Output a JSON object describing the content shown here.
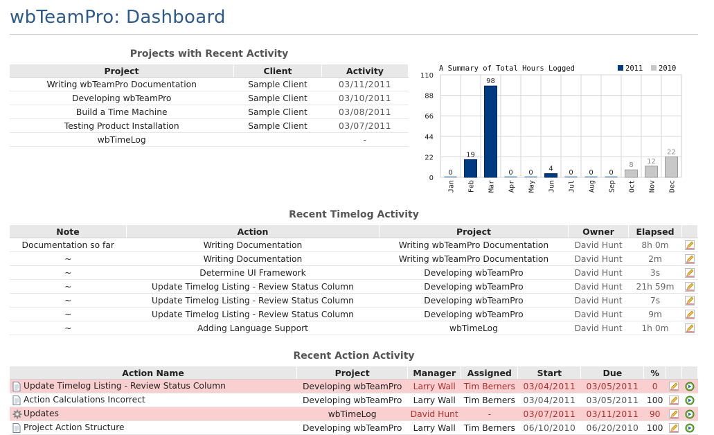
{
  "page": {
    "title": "wbTeamPro: Dashboard"
  },
  "projects": {
    "title": "Projects with Recent Activity",
    "headers": [
      "Project",
      "Client",
      "Activity"
    ],
    "rows": [
      [
        "Writing wbTeamPro Documentation",
        "Sample Client",
        "03/11/2011"
      ],
      [
        "Developing wbTeamPro",
        "Sample Client",
        "03/10/2011"
      ],
      [
        "Build a Time Machine",
        "Sample Client",
        "03/08/2011"
      ],
      [
        "Testing Product Installation",
        "Sample Client",
        "03/07/2011"
      ],
      [
        "wbTimeLog",
        "",
        "-"
      ]
    ]
  },
  "chart_data": {
    "type": "bar",
    "title": "A Summary of Total Hours Logged",
    "categories": [
      "Jan",
      "Feb",
      "Mar",
      "Apr",
      "May",
      "Jun",
      "Jul",
      "Aug",
      "Sep",
      "Oct",
      "Nov",
      "Dec"
    ],
    "series": [
      {
        "name": "2011",
        "color": "#003a80",
        "values": [
          0,
          19,
          98,
          0,
          0,
          4,
          0,
          0,
          0,
          0,
          0,
          0
        ]
      },
      {
        "name": "2010",
        "color": "#c8c8c8",
        "values": [
          0,
          0,
          0,
          0,
          0,
          0,
          0,
          0,
          0,
          8,
          12,
          22
        ]
      }
    ],
    "ylim": [
      0,
      110
    ],
    "yticks": [
      0,
      22,
      44,
      66,
      88,
      110
    ],
    "value_labels": [
      "0",
      "19",
      "98",
      "0",
      "0",
      "4",
      "0",
      "0",
      "0",
      "8",
      "12",
      "22"
    ],
    "grid": true,
    "legend": "top-right"
  },
  "timelog": {
    "title": "Recent Timelog Activity",
    "headers": [
      "Note",
      "Action",
      "Project",
      "Owner",
      "Elapsed"
    ],
    "rows": [
      [
        "Documentation so far",
        "Writing Documentation",
        "Writing wbTeamPro Documentation",
        "David Hunt",
        "8h 0m"
      ],
      [
        "~",
        "Writing Documentation",
        "Writing wbTeamPro Documentation",
        "David Hunt",
        "2m"
      ],
      [
        "~",
        "Determine UI Framework",
        "Developing wbTeamPro",
        "David Hunt",
        "3s"
      ],
      [
        "~",
        "Update Timelog Listing - Review Status Column",
        "Developing wbTeamPro",
        "David Hunt",
        "21h 59m"
      ],
      [
        "~",
        "Update Timelog Listing - Review Status Column",
        "Developing wbTeamPro",
        "David Hunt",
        "7s"
      ],
      [
        "~",
        "Update Timelog Listing - Review Status Column",
        "Developing wbTeamPro",
        "David Hunt",
        "9m"
      ],
      [
        "~",
        "Adding Language Support",
        "wbTimeLog",
        "David Hunt",
        "1h 0m"
      ]
    ],
    "edit_icon": "pencil-edit-icon"
  },
  "actions": {
    "title": "Recent Action Activity",
    "headers": [
      "Action Name",
      "Project",
      "Manager",
      "Assigned",
      "Start",
      "Due",
      "%"
    ],
    "rows": [
      {
        "icon": "document-icon",
        "highlight": true,
        "cells": [
          "Update Timelog Listing - Review Status Column",
          "Developing wbTeamPro",
          "Larry Wall",
          "Tim Berners",
          "03/04/2011",
          "03/05/2011",
          "0"
        ]
      },
      {
        "icon": "document-icon",
        "highlight": false,
        "cells": [
          "Action Calculations Incorrect",
          "Developing wbTeamPro",
          "Larry Wall",
          "Tim Berners",
          "03/04/2011",
          "03/05/2011",
          "100"
        ]
      },
      {
        "icon": "gear-icon",
        "highlight": true,
        "cells": [
          "Updates",
          "wbTimeLog",
          "David Hunt",
          "-",
          "03/07/2011",
          "03/11/2011",
          "90"
        ]
      },
      {
        "icon": "document-icon",
        "highlight": false,
        "cells": [
          "Project Action Structure",
          "Developing wbTeamPro",
          "Larry Wall",
          "Tim Berners",
          "06/10/2010",
          "06/20/2010",
          "100"
        ]
      }
    ],
    "edit_icon": "pencil-edit-icon",
    "view_icon": "go-arrow-icon"
  }
}
